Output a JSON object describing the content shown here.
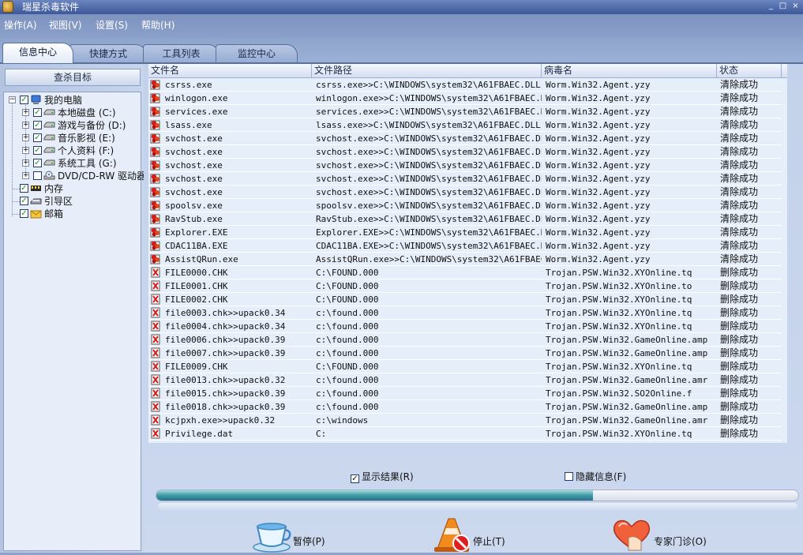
{
  "window": {
    "title": "瑞星杀毒软件",
    "controls": [
      "_",
      "□",
      "×"
    ]
  },
  "menu": [
    "操作(A)",
    "视图(V)",
    "设置(S)",
    "帮助(H)"
  ],
  "tabs": [
    {
      "label": "信息中心",
      "active": true
    },
    {
      "label": "快捷方式",
      "active": false
    },
    {
      "label": "工具列表",
      "active": false
    },
    {
      "label": "监控中心",
      "active": false
    }
  ],
  "left": {
    "header": "查杀目标",
    "tree": [
      {
        "label": "我的电脑",
        "level": 0,
        "checked": true,
        "toggle": "−",
        "icon": "computer"
      },
      {
        "label": "本地磁盘 (C:)",
        "level": 1,
        "checked": true,
        "toggle": "+",
        "icon": "drive"
      },
      {
        "label": "游戏与备份 (D:)",
        "level": 1,
        "checked": true,
        "toggle": "+",
        "icon": "drive"
      },
      {
        "label": "音乐影视 (E:)",
        "level": 1,
        "checked": true,
        "toggle": "+",
        "icon": "drive"
      },
      {
        "label": "个人资料 (F:)",
        "level": 1,
        "checked": true,
        "toggle": "+",
        "icon": "drive"
      },
      {
        "label": "系统工具 (G:)",
        "level": 1,
        "checked": true,
        "toggle": "+",
        "icon": "drive"
      },
      {
        "label": "DVD/CD-RW 驱动器",
        "level": 1,
        "checked": false,
        "toggle": "+",
        "icon": "cdrom"
      },
      {
        "label": "内存",
        "level": 0,
        "checked": true,
        "toggle": "",
        "icon": "memory"
      },
      {
        "label": "引导区",
        "level": 0,
        "checked": true,
        "toggle": "",
        "icon": "boot"
      },
      {
        "label": "邮箱",
        "level": 0,
        "checked": true,
        "toggle": "",
        "icon": "mail"
      }
    ]
  },
  "table": {
    "columns": [
      "文件名",
      "文件路径",
      "病毒名",
      "状态"
    ],
    "rows": [
      {
        "name": "csrss.exe",
        "path": "csrss.exe>>C:\\WINDOWS\\system32\\A61FBAEC.DLL",
        "virus": "Worm.Win32.Agent.yzy",
        "status": "清除成功",
        "kind": "virus"
      },
      {
        "name": "winlogon.exe",
        "path": "winlogon.exe>>C:\\WINDOWS\\system32\\A61FBAEC.DLL",
        "virus": "Worm.Win32.Agent.yzy",
        "status": "清除成功",
        "kind": "virus"
      },
      {
        "name": "services.exe",
        "path": "services.exe>>C:\\WINDOWS\\system32\\A61FBAEC.DLL",
        "virus": "Worm.Win32.Agent.yzy",
        "status": "清除成功",
        "kind": "virus"
      },
      {
        "name": "lsass.exe",
        "path": "lsass.exe>>C:\\WINDOWS\\system32\\A61FBAEC.DLL",
        "virus": "Worm.Win32.Agent.yzy",
        "status": "清除成功",
        "kind": "virus"
      },
      {
        "name": "svchost.exe",
        "path": "svchost.exe>>C:\\WINDOWS\\system32\\A61FBAEC.DLL",
        "virus": "Worm.Win32.Agent.yzy",
        "status": "清除成功",
        "kind": "virus"
      },
      {
        "name": "svchost.exe",
        "path": "svchost.exe>>C:\\WINDOWS\\system32\\A61FBAEC.DLL",
        "virus": "Worm.Win32.Agent.yzy",
        "status": "清除成功",
        "kind": "virus"
      },
      {
        "name": "svchost.exe",
        "path": "svchost.exe>>C:\\WINDOWS\\system32\\A61FBAEC.DLL",
        "virus": "Worm.Win32.Agent.yzy",
        "status": "清除成功",
        "kind": "virus"
      },
      {
        "name": "svchost.exe",
        "path": "svchost.exe>>C:\\WINDOWS\\system32\\A61FBAEC.DLL",
        "virus": "Worm.Win32.Agent.yzy",
        "status": "清除成功",
        "kind": "virus"
      },
      {
        "name": "svchost.exe",
        "path": "svchost.exe>>C:\\WINDOWS\\system32\\A61FBAEC.DLL",
        "virus": "Worm.Win32.Agent.yzy",
        "status": "清除成功",
        "kind": "virus"
      },
      {
        "name": "spoolsv.exe",
        "path": "spoolsv.exe>>C:\\WINDOWS\\system32\\A61FBAEC.DLL",
        "virus": "Worm.Win32.Agent.yzy",
        "status": "清除成功",
        "kind": "virus"
      },
      {
        "name": "RavStub.exe",
        "path": "RavStub.exe>>C:\\WINDOWS\\system32\\A61FBAEC.DLL",
        "virus": "Worm.Win32.Agent.yzy",
        "status": "清除成功",
        "kind": "virus"
      },
      {
        "name": "Explorer.EXE",
        "path": "Explorer.EXE>>C:\\WINDOWS\\system32\\A61FBAEC.DLL",
        "virus": "Worm.Win32.Agent.yzy",
        "status": "清除成功",
        "kind": "virus"
      },
      {
        "name": "CDAC11BA.EXE",
        "path": "CDAC11BA.EXE>>C:\\WINDOWS\\system32\\A61FBAEC.DLL",
        "virus": "Worm.Win32.Agent.yzy",
        "status": "清除成功",
        "kind": "virus"
      },
      {
        "name": "AssistQRun.exe",
        "path": "AssistQRun.exe>>C:\\WINDOWS\\system32\\A61FBAEC...",
        "virus": "Worm.Win32.Agent.yzy",
        "status": "清除成功",
        "kind": "virus"
      },
      {
        "name": "FILE0000.CHK",
        "path": "C:\\FOUND.000",
        "virus": "Trojan.PSW.Win32.XYOnline.tq",
        "status": "删除成功",
        "kind": "deleted"
      },
      {
        "name": "FILE0001.CHK",
        "path": "C:\\FOUND.000",
        "virus": "Trojan.PSW.Win32.XYOnline.to",
        "status": "删除成功",
        "kind": "deleted"
      },
      {
        "name": "FILE0002.CHK",
        "path": "C:\\FOUND.000",
        "virus": "Trojan.PSW.Win32.XYOnline.tq",
        "status": "删除成功",
        "kind": "deleted"
      },
      {
        "name": "file0003.chk>>upack0.34",
        "path": "c:\\found.000",
        "virus": "Trojan.PSW.Win32.XYOnline.tq",
        "status": "删除成功",
        "kind": "deleted"
      },
      {
        "name": "file0004.chk>>upack0.34",
        "path": "c:\\found.000",
        "virus": "Trojan.PSW.Win32.XYOnline.tq",
        "status": "删除成功",
        "kind": "deleted"
      },
      {
        "name": "file0006.chk>>upack0.39",
        "path": "c:\\found.000",
        "virus": "Trojan.PSW.Win32.GameOnline.amp",
        "status": "删除成功",
        "kind": "deleted"
      },
      {
        "name": "file0007.chk>>upack0.39",
        "path": "c:\\found.000",
        "virus": "Trojan.PSW.Win32.GameOnline.amp",
        "status": "删除成功",
        "kind": "deleted"
      },
      {
        "name": "FILE0009.CHK",
        "path": "C:\\FOUND.000",
        "virus": "Trojan.PSW.Win32.XYOnline.tq",
        "status": "删除成功",
        "kind": "deleted"
      },
      {
        "name": "file0013.chk>>upack0.32",
        "path": "c:\\found.000",
        "virus": "Trojan.PSW.Win32.GameOnline.amr",
        "status": "删除成功",
        "kind": "deleted"
      },
      {
        "name": "file0015.chk>>upack0.39",
        "path": "c:\\found.000",
        "virus": "Trojan.PSW.Win32.SO2Online.f",
        "status": "删除成功",
        "kind": "deleted"
      },
      {
        "name": "file0018.chk>>upack0.39",
        "path": "c:\\found.000",
        "virus": "Trojan.PSW.Win32.GameOnline.amp",
        "status": "删除成功",
        "kind": "deleted"
      },
      {
        "name": "kcjpxh.exe>>upack0.32",
        "path": "c:\\windows",
        "virus": "Trojan.PSW.Win32.GameOnline.amr",
        "status": "删除成功",
        "kind": "deleted"
      },
      {
        "name": "Privilege.dat",
        "path": "C:",
        "virus": "Trojan.PSW.Win32.XYOnline.tq",
        "status": "删除成功",
        "kind": "deleted"
      }
    ]
  },
  "options": {
    "show_results": {
      "label": "显示结果(R)",
      "checked": true
    },
    "hide_info": {
      "label": "隐藏信息(F)",
      "checked": false
    }
  },
  "progress": {
    "fraction": 0.68
  },
  "buttons": {
    "pause": "暂停(P)",
    "stop": "停止(T)",
    "expert": "专家门诊(O)"
  },
  "colors": {
    "accent": "#56709f",
    "progress": "#3f9aa5"
  }
}
